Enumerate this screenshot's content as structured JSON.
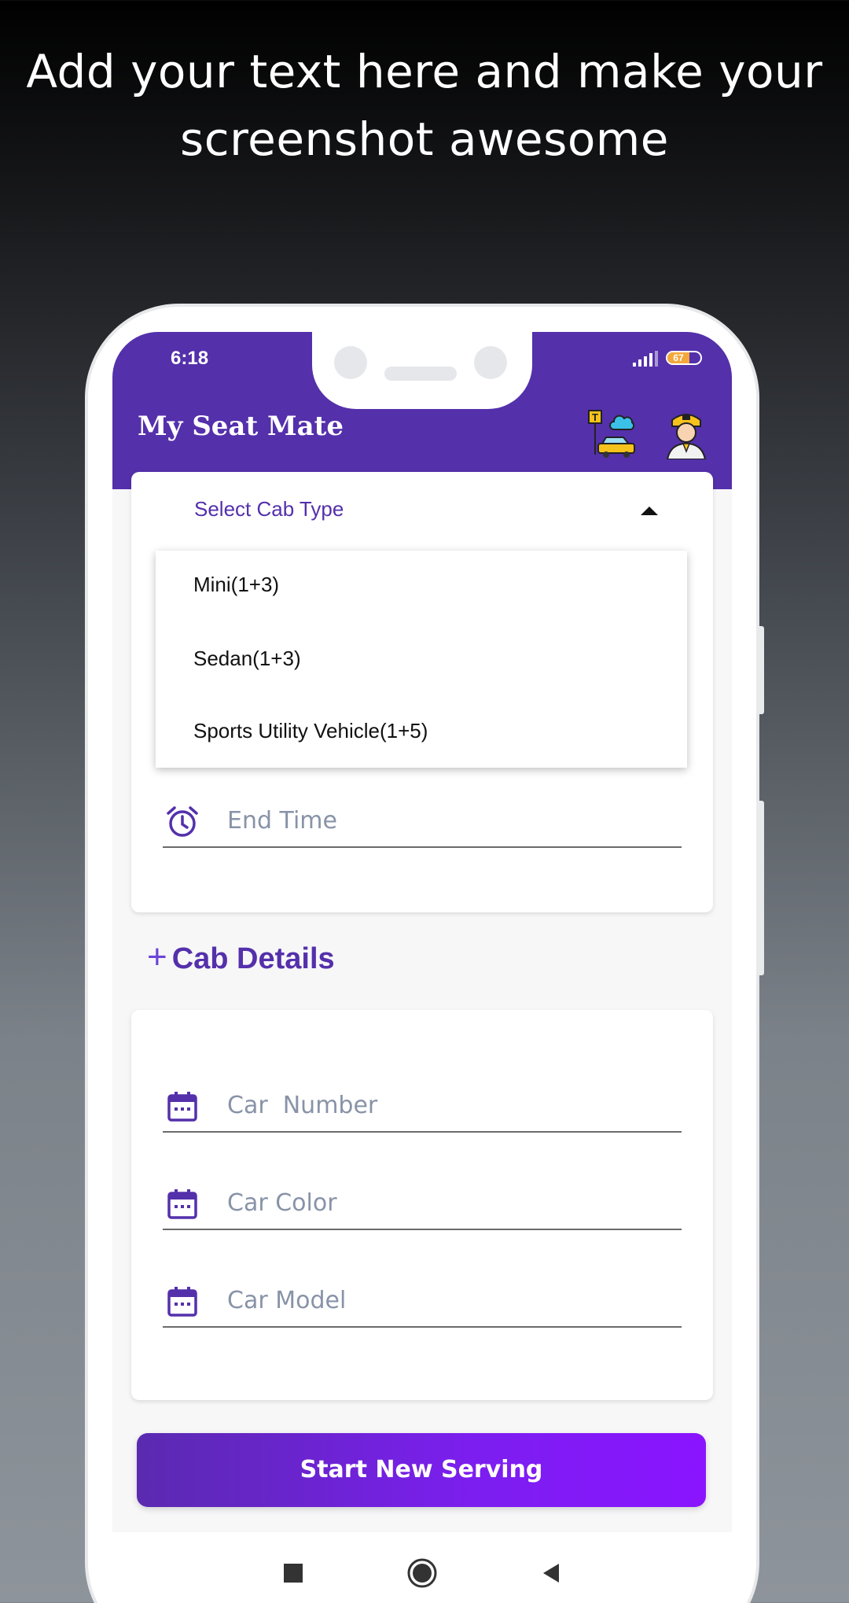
{
  "promo": {
    "line1": "Add your text here and make your",
    "line2": "screenshot awesome"
  },
  "status_bar": {
    "time": "6:18",
    "battery_level": "67",
    "icons": [
      "signal-icon",
      "battery-icon"
    ]
  },
  "app_bar": {
    "title": "My Seat Mate",
    "icons": [
      "taxi-stand-icon",
      "driver-avatar-icon"
    ],
    "color": "#5430ab"
  },
  "cab_type": {
    "label": "Select Cab Type",
    "options": [
      "Mini(1+3)",
      "Sedan(1+3)",
      "Sports Utility Vehicle(1+5)"
    ]
  },
  "timing": {
    "end_time_placeholder": "End Time"
  },
  "cab_details": {
    "title": "Cab Details",
    "car_number_placeholder": "Car  Number",
    "car_color_placeholder": "Car Color",
    "car_model_placeholder": "Car Model"
  },
  "actions": {
    "start_label": "Start New Serving"
  },
  "nav": {
    "icons": [
      "recents-icon",
      "home-icon",
      "back-icon"
    ]
  },
  "colors": {
    "accent": "#5430ab",
    "button_start": "#5a2ab0",
    "button_end": "#8a14ff",
    "placeholder": "#8893a8"
  }
}
